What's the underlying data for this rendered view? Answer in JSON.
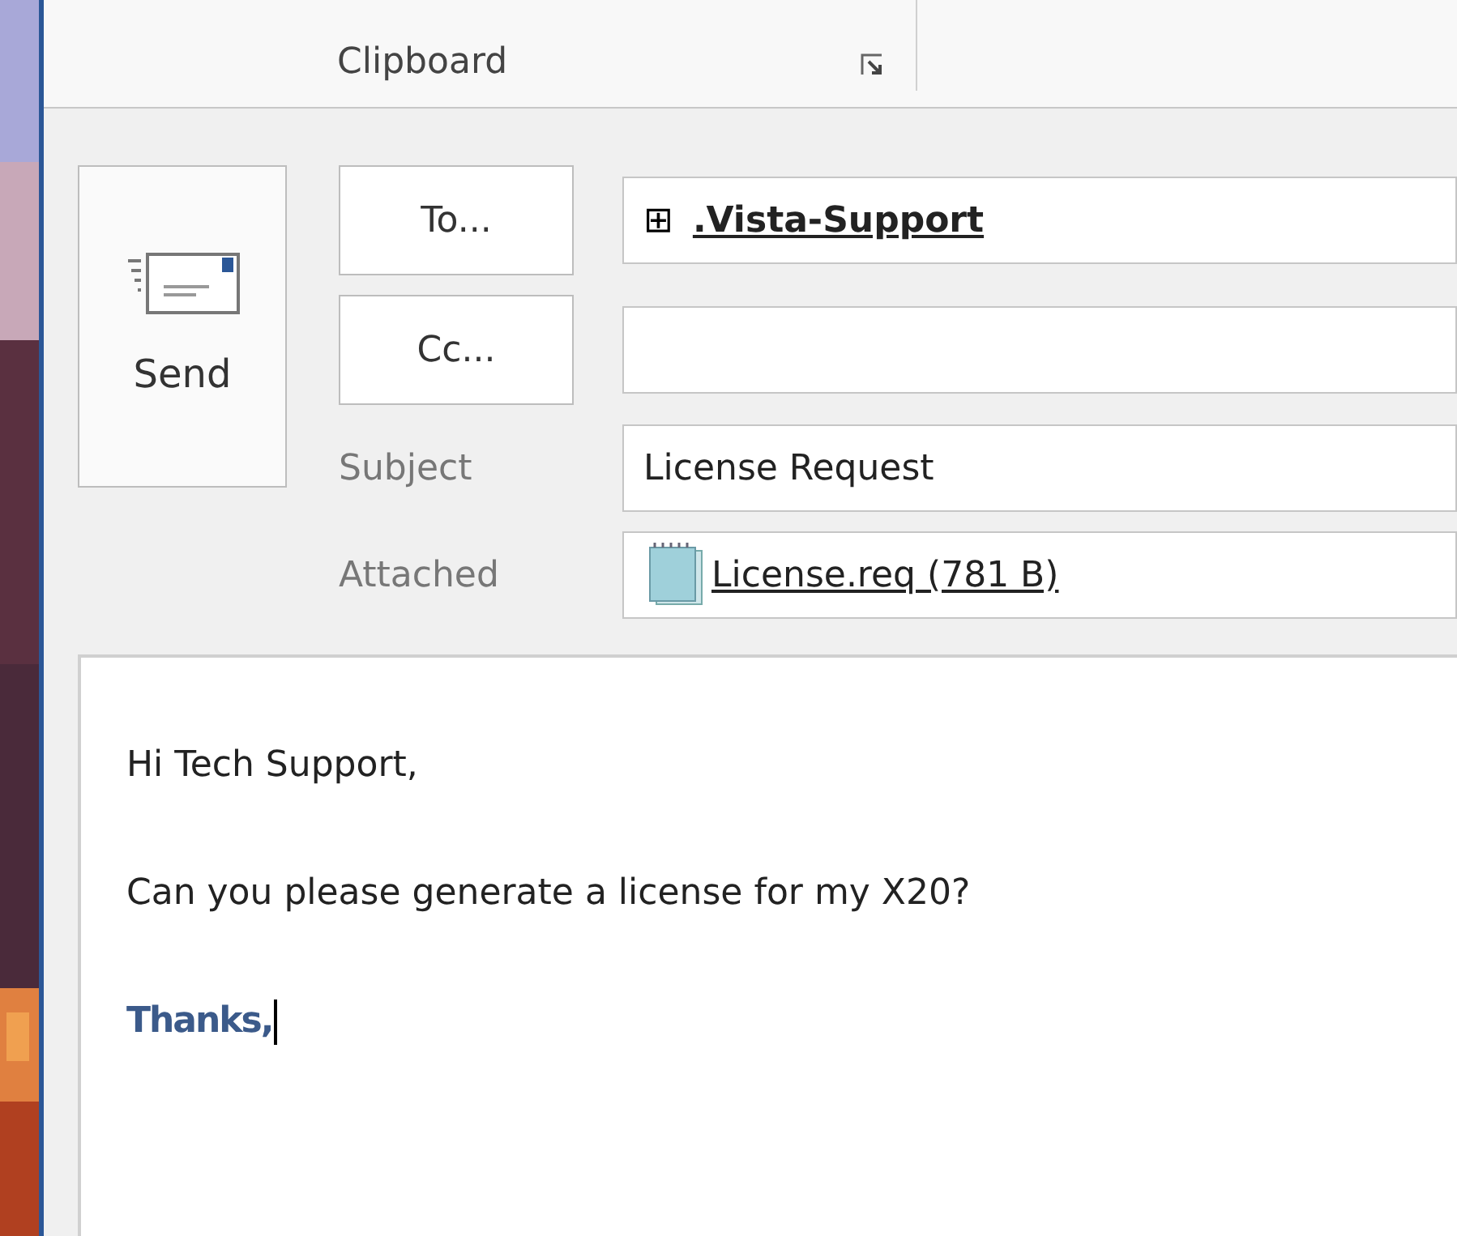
{
  "ribbon": {
    "group_label": "Clipboard"
  },
  "compose": {
    "send_label": "Send",
    "to": {
      "button": "To...",
      "recipient": ".Vista-Support",
      "expand_glyph": "⊞"
    },
    "cc": {
      "button": "Cc..."
    },
    "subject": {
      "label": "Subject",
      "value": "License Request"
    },
    "attached": {
      "label": "Attached",
      "file": "License.req (781 B)"
    }
  },
  "body": {
    "lines": [
      {
        "text": "Hi Tech Support,",
        "bold": false
      },
      {
        "text": "Can you please generate a license for my X20?",
        "bold": false
      },
      {
        "text": "Thanks,",
        "bold": true
      }
    ],
    "cursor_after_last": true
  }
}
